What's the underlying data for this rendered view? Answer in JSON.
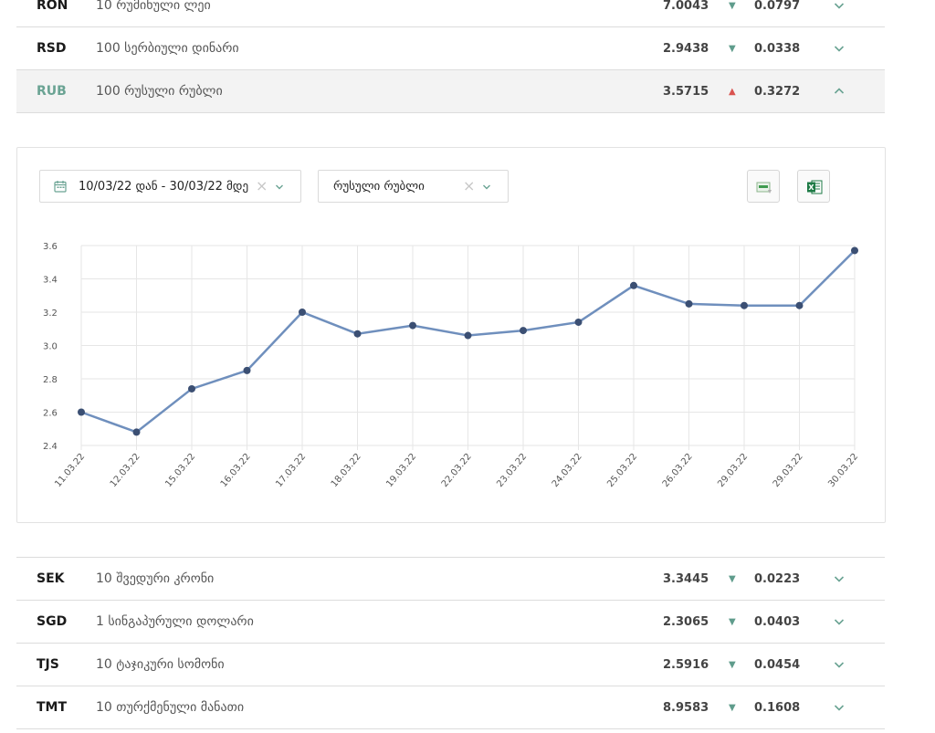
{
  "rows_top": [
    {
      "code": "RON",
      "name": "10 რუმინული ლეი",
      "rate": "7.0043",
      "direction": "down",
      "change": "0.0797",
      "expanded": false
    },
    {
      "code": "RSD",
      "name": "100 სერბიული დინარი",
      "rate": "2.9438",
      "direction": "down",
      "change": "0.0338",
      "expanded": false
    },
    {
      "code": "RUB",
      "name": "100 რუსული რუბლი",
      "rate": "3.5715",
      "direction": "up",
      "change": "0.3272",
      "expanded": true
    }
  ],
  "rows_bottom": [
    {
      "code": "SEK",
      "name": "10 შვედური კრონი",
      "rate": "3.3445",
      "direction": "down",
      "change": "0.0223",
      "expanded": false
    },
    {
      "code": "SGD",
      "name": "1 სინგაპურული დოლარი",
      "rate": "2.3065",
      "direction": "down",
      "change": "0.0403",
      "expanded": false
    },
    {
      "code": "TJS",
      "name": "10 ტაჯიკური სომონი",
      "rate": "2.5916",
      "direction": "down",
      "change": "0.0454",
      "expanded": false
    },
    {
      "code": "TMT",
      "name": "10 თურქმენული მანათი",
      "rate": "8.9583",
      "direction": "down",
      "change": "0.1608",
      "expanded": false
    }
  ],
  "filters": {
    "date_range": "10/03/22 დან - 30/03/22 მდე",
    "currency": "რუსული რუბლი"
  },
  "colors": {
    "line": "#6f8fbd",
    "point": "#3b4f73",
    "accent": "#6aa393",
    "up": "#d9534f",
    "down": "#5f9c8c"
  },
  "icons": {
    "calendar": "calendar-icon",
    "clear": "close-icon",
    "dropdown": "chevron-down-icon",
    "export_csv": "csv-export-icon",
    "export_excel": "excel-export-icon"
  },
  "chart_data": {
    "type": "line",
    "categories": [
      "11.03.22",
      "12.03.22",
      "15.03.22",
      "16.03.22",
      "17.03.22",
      "18.03.22",
      "19.03.22",
      "22.03.22",
      "23.03.22",
      "24.03.22",
      "25.03.22",
      "26.03.22",
      "29.03.22",
      "29.03.22",
      "30.03.22"
    ],
    "values": [
      2.6,
      2.48,
      2.74,
      2.85,
      3.2,
      3.07,
      3.12,
      3.06,
      3.09,
      3.14,
      3.36,
      3.25,
      3.24,
      3.24,
      3.57
    ],
    "ylim": [
      2.4,
      3.6
    ],
    "yticks": [
      "3.6",
      "3.4",
      "3.2",
      "3.0",
      "2.8",
      "2.6",
      "2.4"
    ],
    "grid": true,
    "title": "",
    "xlabel": "",
    "ylabel": ""
  }
}
